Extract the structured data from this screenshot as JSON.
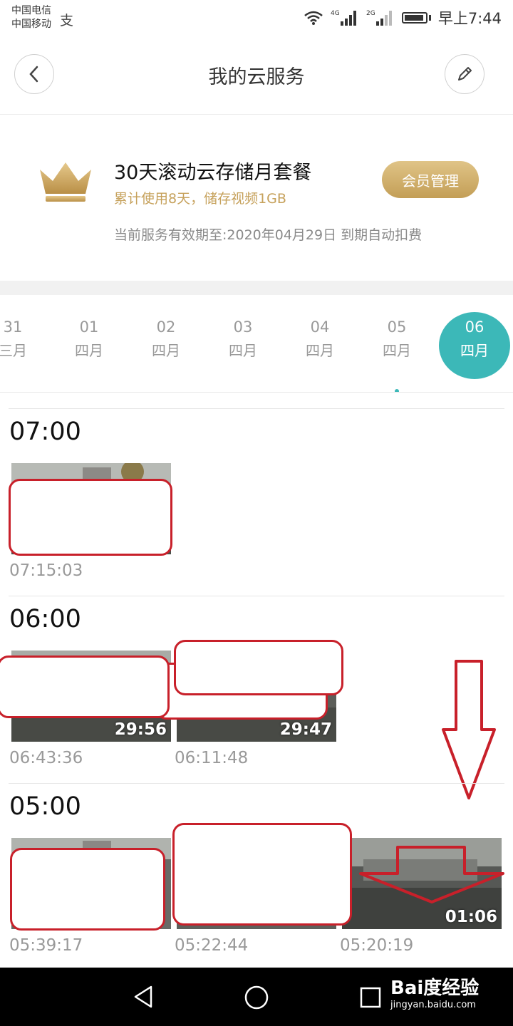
{
  "status_bar": {
    "carrier_1": "中国电信",
    "carrier_2": "中国移动",
    "alipay_glyph": "支",
    "net_4g": "4G",
    "net_2g": "2G",
    "time": "早上7:44"
  },
  "header": {
    "title": "我的云服务",
    "back_icon": "chevron-left-icon",
    "edit_icon": "pencil-icon"
  },
  "plan": {
    "title": "30天滚动云存储月套餐",
    "usage": "累计使用8天，储存视频1GB",
    "expiry": "当前服务有效期至:2020年04月29日 到期自动扣费",
    "member_button": "会员管理",
    "crown_icon": "crown-icon",
    "gold_color": "#c6a15b"
  },
  "date_strip": {
    "accent_color": "#3cb8b8",
    "dates": [
      {
        "day": "31",
        "month": "三月"
      },
      {
        "day": "01",
        "month": "四月"
      },
      {
        "day": "02",
        "month": "四月"
      },
      {
        "day": "03",
        "month": "四月"
      },
      {
        "day": "04",
        "month": "四月"
      },
      {
        "day": "05",
        "month": "四月",
        "has_recording_dot": true
      },
      {
        "day": "06",
        "month": "四月",
        "selected": true
      }
    ]
  },
  "sections": [
    {
      "hour": "07:00",
      "clips": [
        {
          "time": "07:15:03",
          "duration": ""
        }
      ]
    },
    {
      "hour": "06:00",
      "clips": [
        {
          "time": "06:43:36",
          "duration": "29:56"
        },
        {
          "time": "06:11:48",
          "duration": "29:47"
        }
      ]
    },
    {
      "hour": "05:00",
      "clips": [
        {
          "time": "05:39:17",
          "duration": ""
        },
        {
          "time": "05:22:44",
          "duration": ""
        },
        {
          "time": "05:20:19",
          "duration": "01:06"
        }
      ]
    }
  ],
  "annotation": {
    "color": "#c8202a",
    "arrow_icon": "arrow-down-icon"
  },
  "nav": {
    "back_icon": "triangle-back-icon",
    "home_icon": "circle-home-icon",
    "recents_icon": "square-recents-icon"
  },
  "watermark": {
    "main": "Bai度经验",
    "sub": "jingyan.baidu.com"
  }
}
